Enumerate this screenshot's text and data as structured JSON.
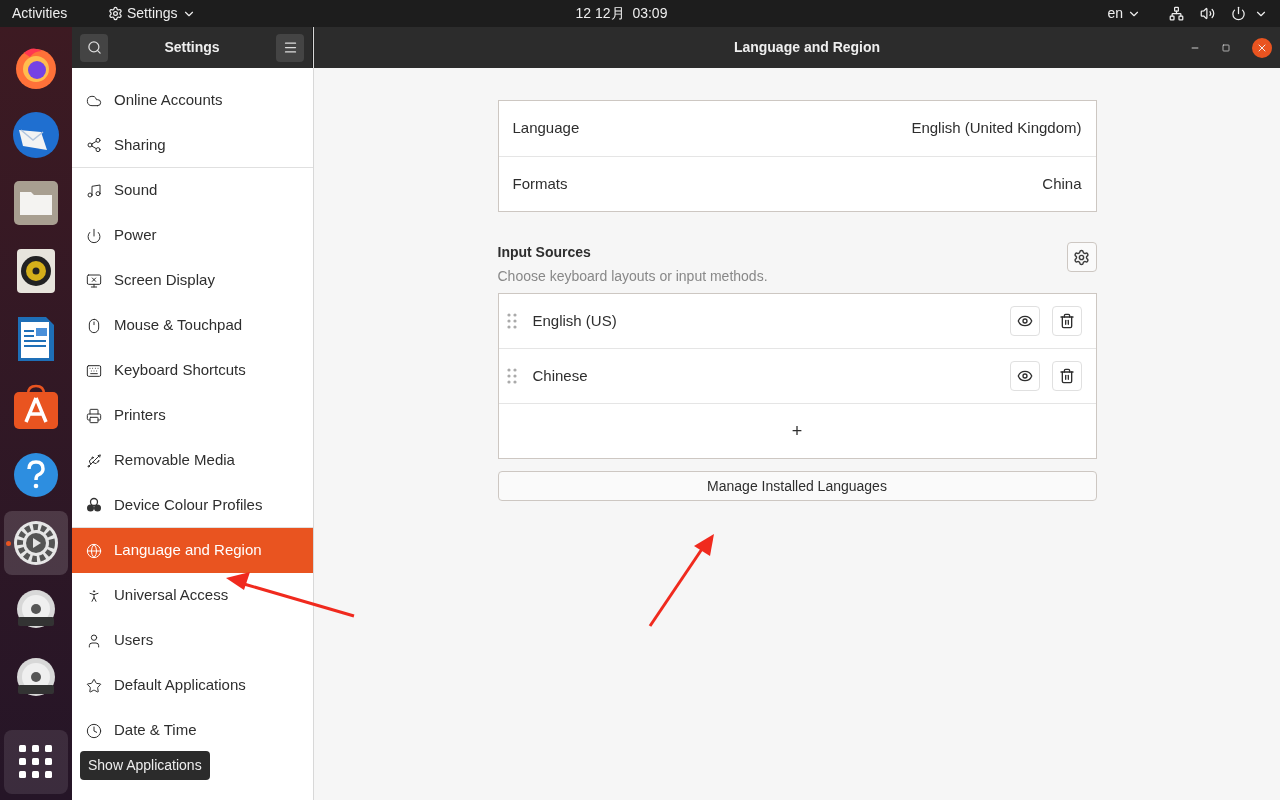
{
  "top_bar": {
    "activities": "Activities",
    "app_menu": "Settings",
    "clock": "12 12月  03:09",
    "input_method": "en"
  },
  "dock": [
    {
      "kind": "firefox",
      "active": false
    },
    {
      "kind": "thunderbird",
      "active": false
    },
    {
      "kind": "files",
      "active": false
    },
    {
      "kind": "rhythmbox",
      "active": false
    },
    {
      "kind": "writer",
      "active": false
    },
    {
      "kind": "software",
      "active": false
    },
    {
      "kind": "help",
      "active": false
    },
    {
      "kind": "settings",
      "active": true
    },
    {
      "kind": "dvd",
      "active": false
    },
    {
      "kind": "dvd",
      "active": false
    }
  ],
  "show_applications_tooltip": "Show Applications",
  "sidebar": {
    "title": "Settings",
    "items": [
      {
        "label": "Online Accounts",
        "kind": "cloud",
        "selected": false,
        "separator_after": false
      },
      {
        "label": "Sharing",
        "kind": "share",
        "selected": false,
        "separator_after": true
      },
      {
        "label": "Sound",
        "kind": "music",
        "selected": false,
        "separator_after": false
      },
      {
        "label": "Power",
        "kind": "power",
        "selected": false,
        "separator_after": false
      },
      {
        "label": "Screen Display",
        "kind": "display",
        "selected": false,
        "separator_after": false
      },
      {
        "label": "Mouse & Touchpad",
        "kind": "mouse",
        "selected": false,
        "separator_after": false
      },
      {
        "label": "Keyboard Shortcuts",
        "kind": "keyboard",
        "selected": false,
        "separator_after": false
      },
      {
        "label": "Printers",
        "kind": "printer",
        "selected": false,
        "separator_after": false
      },
      {
        "label": "Removable Media",
        "kind": "media",
        "selected": false,
        "separator_after": false
      },
      {
        "label": "Device Colour Profiles",
        "kind": "colors",
        "selected": false,
        "separator_after": true
      },
      {
        "label": "Language and Region",
        "kind": "globe",
        "selected": true,
        "separator_after": false
      },
      {
        "label": "Universal Access",
        "kind": "access",
        "selected": false,
        "separator_after": false
      },
      {
        "label": "Users",
        "kind": "user",
        "selected": false,
        "separator_after": false
      },
      {
        "label": "Default Applications",
        "kind": "star",
        "selected": false,
        "separator_after": false
      },
      {
        "label": "Date & Time",
        "kind": "clock",
        "selected": false,
        "separator_after": false
      }
    ]
  },
  "window": {
    "title": "Language and Region"
  },
  "settings": [
    {
      "label": "Language",
      "value": "English (United Kingdom)"
    },
    {
      "label": "Formats",
      "value": "China"
    }
  ],
  "input_sources": {
    "title": "Input Sources",
    "subtitle": "Choose keyboard layouts or input methods.",
    "items": [
      {
        "label": "English (US)"
      },
      {
        "label": "Chinese"
      }
    ],
    "add": "+"
  },
  "manage_button": "Manage Installed Languages"
}
